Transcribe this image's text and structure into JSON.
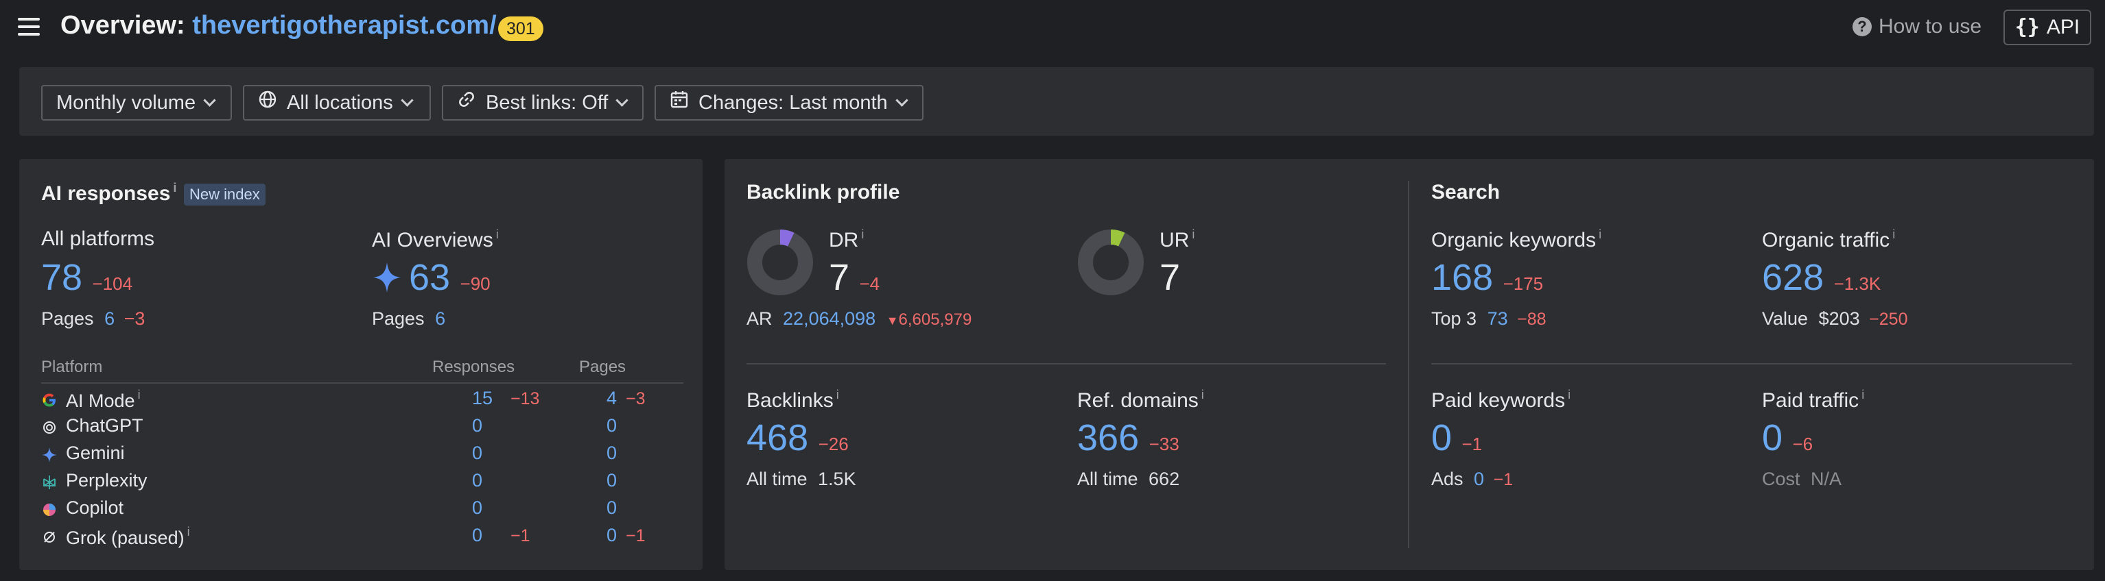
{
  "header": {
    "title_prefix": "Overview: ",
    "domain": "thevertigotherapist.com/",
    "status_badge": "301",
    "how_to_use": "How to use",
    "api_label": "API"
  },
  "filters": [
    {
      "label": "Monthly volume",
      "icon": "none"
    },
    {
      "label": "All locations",
      "icon": "globe-icon"
    },
    {
      "label": "Best links: Off",
      "icon": "link-icon"
    },
    {
      "label": "Changes: Last month",
      "icon": "calendar-icon"
    }
  ],
  "ai_responses": {
    "title": "AI responses",
    "new_index_badge": "New index",
    "all_platforms": {
      "label": "All platforms",
      "value": "78",
      "change": "−104",
      "pages_label": "Pages",
      "pages_value": "6",
      "pages_change": "−3"
    },
    "ai_overviews": {
      "label": "AI Overviews",
      "value": "63",
      "change": "−90",
      "pages_label": "Pages",
      "pages_value": "6"
    },
    "table_headers": {
      "platform": "Platform",
      "responses": "Responses",
      "pages": "Pages"
    },
    "rows": [
      {
        "name": "AI Mode",
        "icon": "google-icon",
        "responses": "15",
        "responses_change": "−13",
        "pages": "4",
        "pages_change": "−3"
      },
      {
        "name": "ChatGPT",
        "icon": "chatgpt-icon",
        "responses": "0",
        "responses_change": "",
        "pages": "0",
        "pages_change": ""
      },
      {
        "name": "Gemini",
        "icon": "gemini-icon",
        "responses": "0",
        "responses_change": "",
        "pages": "0",
        "pages_change": ""
      },
      {
        "name": "Perplexity",
        "icon": "perplexity-icon",
        "responses": "0",
        "responses_change": "",
        "pages": "0",
        "pages_change": ""
      },
      {
        "name": "Copilot",
        "icon": "copilot-icon",
        "responses": "0",
        "responses_change": "",
        "pages": "0",
        "pages_change": ""
      },
      {
        "name": "Grok (paused)",
        "icon": "grok-icon",
        "responses": "0",
        "responses_change": "−1",
        "pages": "0",
        "pages_change": "−1"
      }
    ]
  },
  "backlink_profile": {
    "title": "Backlink profile",
    "dr": {
      "label": "DR",
      "value": "7",
      "change": "−4",
      "fill_fraction": 0.07,
      "color": "#8a6de0"
    },
    "ur": {
      "label": "UR",
      "value": "7",
      "fill_fraction": 0.07,
      "color": "#9bc53d"
    },
    "ar": {
      "label": "AR",
      "value": "22,064,098",
      "change": "6,605,979"
    },
    "backlinks": {
      "label": "Backlinks",
      "value": "468",
      "change": "−26",
      "sub_label": "All time",
      "sub_value": "1.5K"
    },
    "ref_domains": {
      "label": "Ref. domains",
      "value": "366",
      "change": "−33",
      "sub_label": "All time",
      "sub_value": "662"
    }
  },
  "search": {
    "title": "Search",
    "organic_keywords": {
      "label": "Organic keywords",
      "value": "168",
      "change": "−175",
      "sub_label": "Top 3",
      "sub_value": "73",
      "sub_change": "−88"
    },
    "organic_traffic": {
      "label": "Organic traffic",
      "value": "628",
      "change": "−1.3K",
      "sub_label": "Value",
      "sub_value": "$203",
      "sub_change": "−250"
    },
    "paid_keywords": {
      "label": "Paid keywords",
      "value": "0",
      "change": "−1",
      "sub_label": "Ads",
      "sub_value": "0",
      "sub_change": "−1"
    },
    "paid_traffic": {
      "label": "Paid traffic",
      "value": "0",
      "change": "−6",
      "sub_label": "Cost",
      "sub_value": "N/A"
    }
  }
}
